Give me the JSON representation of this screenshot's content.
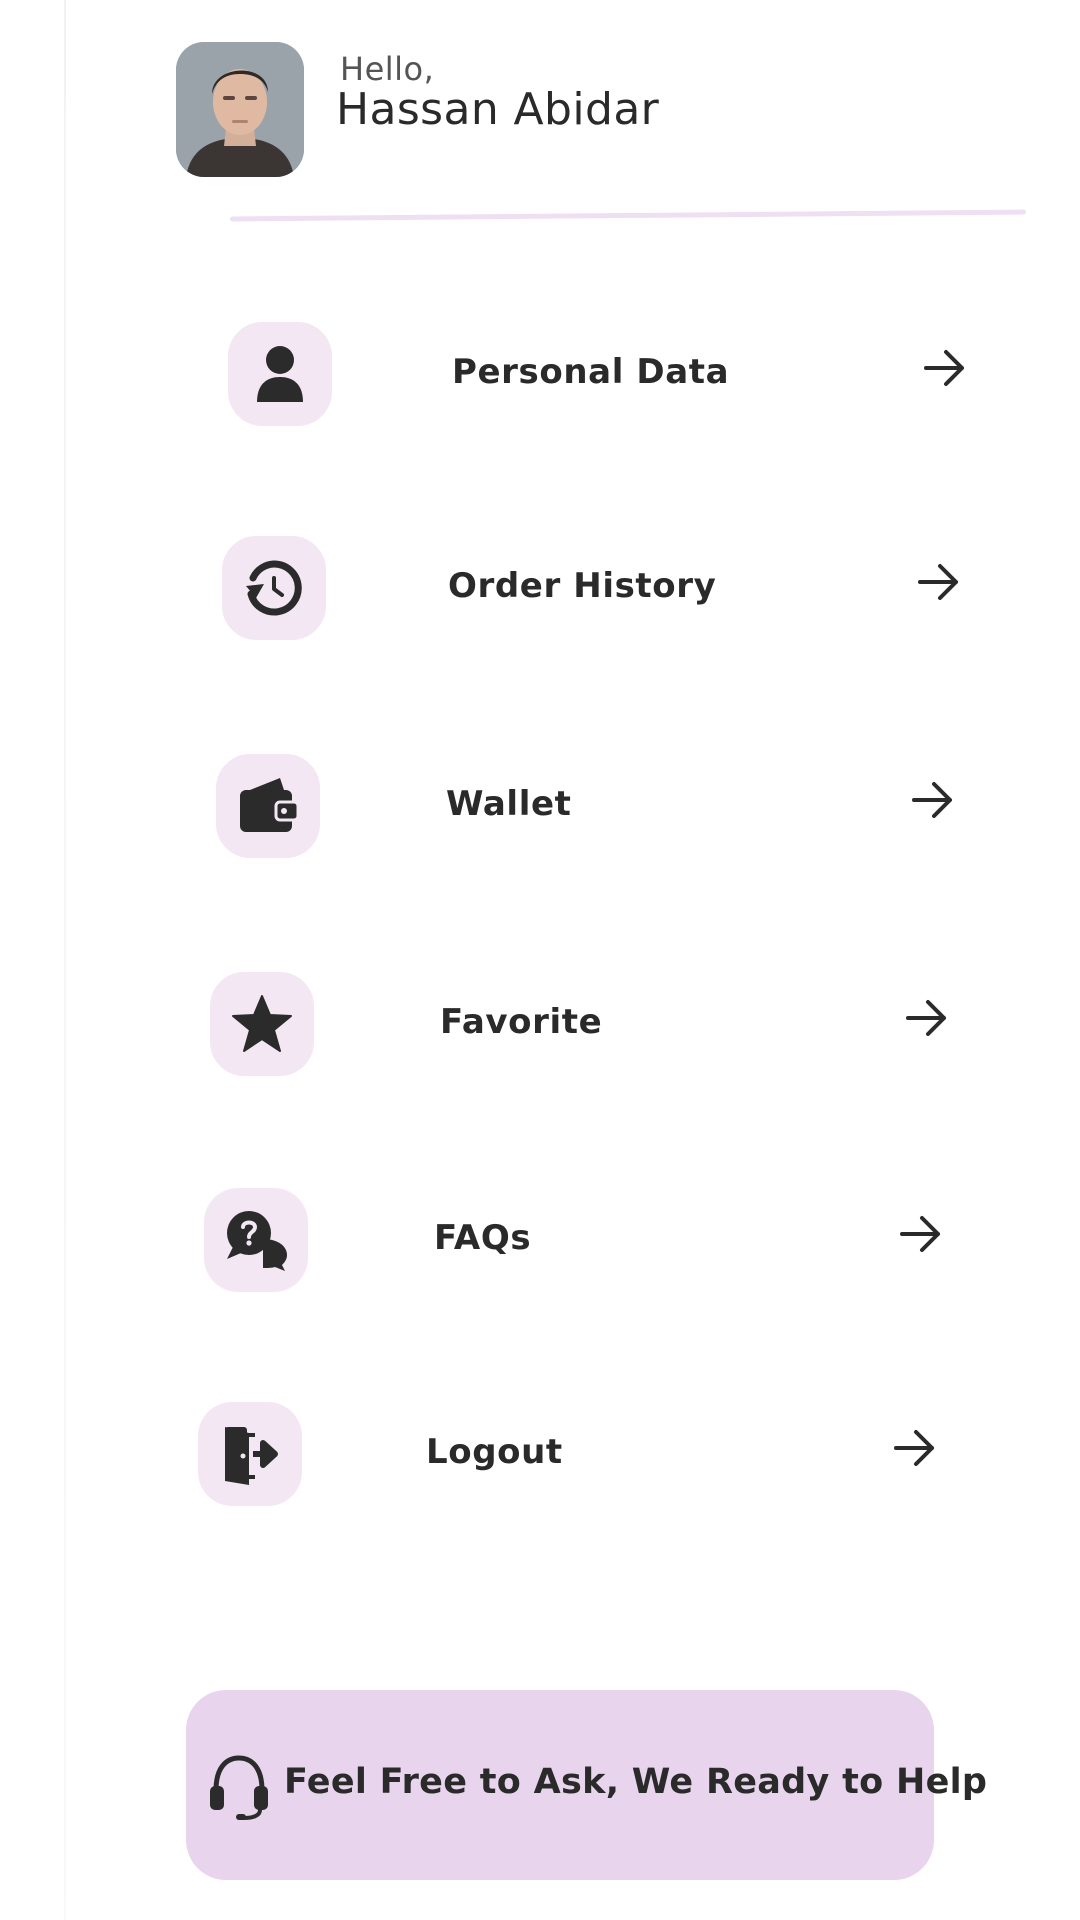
{
  "header": {
    "greeting": "Hello,",
    "user_name": "Hassan Abidar",
    "avatar_icon": "user-photo"
  },
  "menu": {
    "items": [
      {
        "label": "Personal Data",
        "icon": "person-icon"
      },
      {
        "label": "Order History",
        "icon": "history-icon"
      },
      {
        "label": "Wallet",
        "icon": "wallet-icon"
      },
      {
        "label": "Favorite",
        "icon": "star-icon"
      },
      {
        "label": "FAQs",
        "icon": "question-chat-icon"
      },
      {
        "label": "Logout",
        "icon": "logout-door-icon"
      }
    ],
    "arrow_icon": "arrow-right-icon"
  },
  "help": {
    "label": "Feel Free to Ask, We Ready to Help",
    "icon": "headset-icon"
  },
  "colors": {
    "icon_bg": "#f3e7f4",
    "help_bg": "#e9d4ee",
    "text": "#2a2a2a",
    "divider": "#efdff3"
  }
}
